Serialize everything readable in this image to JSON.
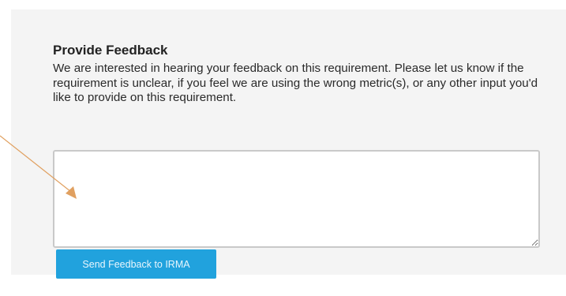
{
  "feedback": {
    "title": "Provide Feedback",
    "description": "We are interested in hearing your feedback on this requirement. Please let us know if the requirement is unclear, if you feel we are using the wrong metric(s), or any other input you'd like to provide on this requirement.",
    "input_value": "",
    "send_button_label": "Send Feedback to IRMA"
  },
  "colors": {
    "panel_background": "#f4f4f4",
    "button": "#21a2dd",
    "annotation_arrow": "#e0a060"
  },
  "icons": {
    "annotation": "arrow-icon",
    "textarea_resize": "resize-handle-icon"
  }
}
